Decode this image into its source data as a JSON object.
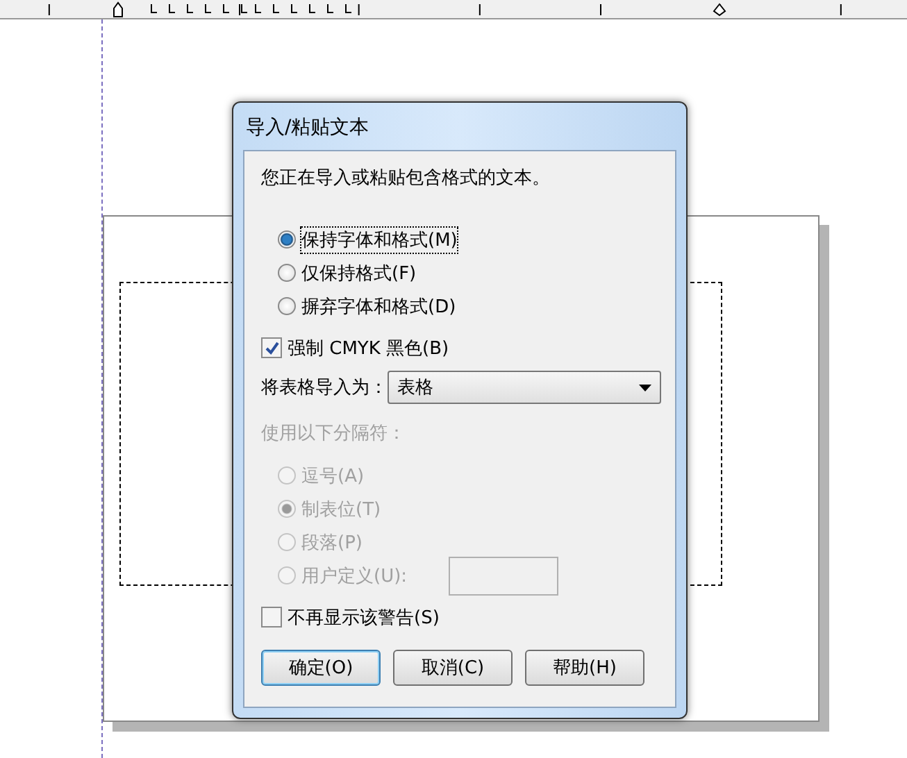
{
  "dialog": {
    "title": "导入/粘贴文本",
    "message": "您正在导入或粘贴包含格式的文本。",
    "format_options": [
      {
        "label": "保持字体和格式(M)",
        "selected": true
      },
      {
        "label": "仅保持格式(F)",
        "selected": false
      },
      {
        "label": "摒弃字体和格式(D)",
        "selected": false
      }
    ],
    "force_black": {
      "label": "强制 CMYK 黑色(B)",
      "checked": true
    },
    "table_import": {
      "label": "将表格导入为：",
      "value": "表格"
    },
    "delimiter": {
      "label": "使用以下分隔符：",
      "disabled": true,
      "options": [
        {
          "label": "逗号(A)",
          "selected": false
        },
        {
          "label": "制表位(T)",
          "selected": true
        },
        {
          "label": "段落(P)",
          "selected": false
        },
        {
          "label": "用户定义(U):",
          "selected": false,
          "has_field": true
        }
      ]
    },
    "no_warning": {
      "label": "不再显示该警告(S)",
      "checked": false
    },
    "buttons": [
      {
        "label": "确定(O)",
        "default": true
      },
      {
        "label": "取消(C)",
        "default": false
      },
      {
        "label": "帮助(H)",
        "default": false
      }
    ]
  }
}
